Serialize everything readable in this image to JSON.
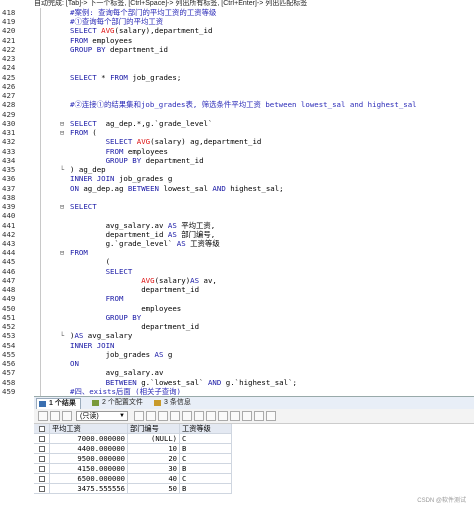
{
  "hint_bar": "自动完成: [Tab]-> 下一个标签, [Ctrl+Space]-> 列出所有标签, [Ctrl+Enter]-> 列出匹配标签",
  "editor": {
    "lines": [
      {
        "n": "418",
        "code": "#案例: 查询每个部门的平均工资的工资等级",
        "type": "cm"
      },
      {
        "n": "419",
        "code": "#①查询每个部门的平均工资",
        "type": "cm"
      },
      {
        "n": "420",
        "code": "SELECT AVG(salary),department_id",
        "type": "sql1"
      },
      {
        "n": "421",
        "code": "FROM employees",
        "type": "sql2"
      },
      {
        "n": "422",
        "code": "GROUP BY department_id",
        "type": "sql3"
      },
      {
        "n": "423",
        "code": "",
        "type": "plain"
      },
      {
        "n": "424",
        "code": "",
        "type": "plain"
      },
      {
        "n": "425",
        "code": "SELECT * FROM job_grades;",
        "type": "sql4"
      },
      {
        "n": "426",
        "code": "",
        "type": "plain"
      },
      {
        "n": "427",
        "code": "",
        "type": "plain"
      },
      {
        "n": "428",
        "code": "#②连接①的结果集和job_grades表, 筛选条件平均工资 between lowest_sal and highest_sal",
        "type": "cm"
      },
      {
        "n": "429",
        "code": "",
        "type": "plain"
      },
      {
        "n": "430",
        "code": "SELECT  ag_dep.*,g.`grade_level`",
        "type": "sql5"
      },
      {
        "n": "431",
        "code": "FROM (",
        "type": "sql6"
      },
      {
        "n": "432",
        "code": "        SELECT AVG(salary) ag,department_id",
        "type": "sql7"
      },
      {
        "n": "433",
        "code": "        FROM employees",
        "type": "sql2i"
      },
      {
        "n": "434",
        "code": "        GROUP BY department_id",
        "type": "sql3i"
      },
      {
        "n": "435",
        "code": ") ag_dep",
        "type": "plain"
      },
      {
        "n": "436",
        "code": "INNER JOIN job_grades g",
        "type": "sql8"
      },
      {
        "n": "437",
        "code": "ON ag_dep.ag BETWEEN lowest_sal AND highest_sal;",
        "type": "sql9"
      },
      {
        "n": "438",
        "code": "",
        "type": "plain"
      },
      {
        "n": "439",
        "code": "SELECT",
        "type": "sqlkw"
      },
      {
        "n": "440",
        "code": "",
        "type": "plain"
      },
      {
        "n": "441",
        "code": "        avg_salary.av AS 平均工资,",
        "type": "sqlas1"
      },
      {
        "n": "442",
        "code": "        department_id AS 部门编号,",
        "type": "sqlas2"
      },
      {
        "n": "443",
        "code": "        g.`grade_level` AS 工资等级",
        "type": "sqlas3"
      },
      {
        "n": "444",
        "code": "FROM",
        "type": "sqlkw"
      },
      {
        "n": "445",
        "code": "        (",
        "type": "plain"
      },
      {
        "n": "446",
        "code": "        SELECT",
        "type": "sqlkwi"
      },
      {
        "n": "447",
        "code": "                AVG(salary)AS av,",
        "type": "sqlav"
      },
      {
        "n": "448",
        "code": "                department_id",
        "type": "plain"
      },
      {
        "n": "449",
        "code": "        FROM",
        "type": "sqlkwi"
      },
      {
        "n": "450",
        "code": "                employees",
        "type": "plain"
      },
      {
        "n": "451",
        "code": "        GROUP BY",
        "type": "sqlkwi"
      },
      {
        "n": "452",
        "code": "                department_id",
        "type": "plain"
      },
      {
        "n": "453",
        "code": ")AS avg_salary",
        "type": "sqlas4"
      },
      {
        "n": "454",
        "code": "INNER JOIN",
        "type": "sqlkw"
      },
      {
        "n": "455",
        "code": "        job_grades AS g",
        "type": "sqlas5"
      },
      {
        "n": "456",
        "code": "ON",
        "type": "sqlkw"
      },
      {
        "n": "457",
        "code": "        avg_salary.av",
        "type": "plain"
      },
      {
        "n": "458",
        "code": "        BETWEEN g.`lowest_sal` AND g.`highest_sal`;",
        "type": "sqlbt"
      },
      {
        "n": "459",
        "code": "#四、exists后面 (相关子查询)",
        "type": "cm"
      }
    ]
  },
  "results": {
    "tabs": [
      {
        "label": "1 个结果",
        "active": true
      },
      {
        "label": "2 个配置文件",
        "active": false
      },
      {
        "label": "3 条信息",
        "active": false
      }
    ],
    "mode_select": "(只读)",
    "columns": [
      "平均工资",
      "部门编号",
      "工资等级"
    ],
    "rows": [
      [
        "7000.000000",
        "(NULL)",
        "C"
      ],
      [
        "4400.000000",
        "10",
        "B"
      ],
      [
        "9500.000000",
        "20",
        "C"
      ],
      [
        "4150.000000",
        "30",
        "B"
      ],
      [
        "6500.000000",
        "40",
        "C"
      ],
      [
        "3475.555556",
        "50",
        "B"
      ]
    ]
  },
  "watermark": "CSDN @软件测试"
}
